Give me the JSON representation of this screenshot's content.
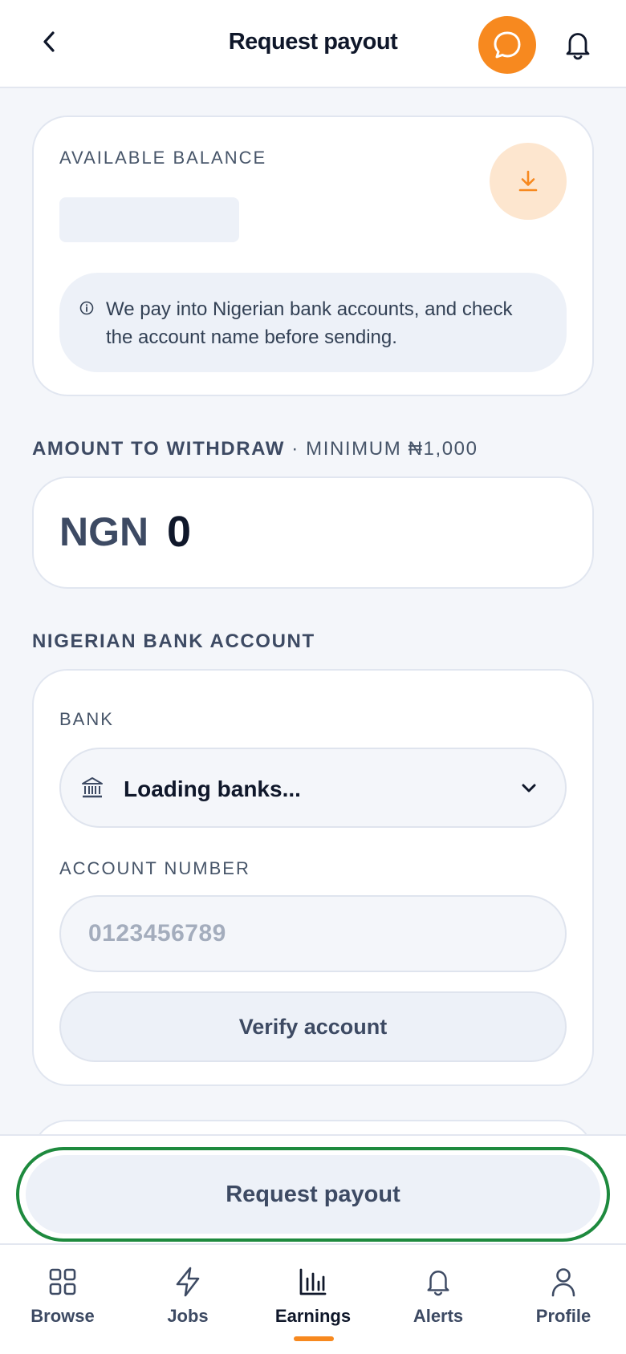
{
  "header": {
    "title": "Request payout",
    "back_icon": "chevron-left-icon",
    "chat_icon": "chat-bubble-icon",
    "notifications_icon": "bell-icon"
  },
  "balance": {
    "label": "AVAILABLE BALANCE",
    "download_icon": "download-icon",
    "info_icon": "info-icon",
    "info_text": "We pay into Nigerian bank accounts, and check the account name before sending."
  },
  "amount": {
    "section_title": "AMOUNT TO WITHDRAW",
    "section_separator": " · ",
    "section_minimum": "MINIMUM ₦1,000",
    "currency": "NGN",
    "value": "0"
  },
  "bank_account": {
    "section_title": "NIGERIAN BANK ACCOUNT",
    "bank_label": "BANK",
    "bank_icon": "bank-icon",
    "bank_select_value": "Loading banks...",
    "account_number_label": "ACCOUNT NUMBER",
    "account_number_placeholder": "0123456789",
    "account_number_value": "",
    "verify_label": "Verify account"
  },
  "footer": {
    "request_payout_label": "Request payout"
  },
  "nav": {
    "items": [
      {
        "label": "Browse",
        "icon": "grid-icon"
      },
      {
        "label": "Jobs",
        "icon": "lightning-icon"
      },
      {
        "label": "Earnings",
        "icon": "bar-chart-icon",
        "active": true
      },
      {
        "label": "Alerts",
        "icon": "bell-icon"
      },
      {
        "label": "Profile",
        "icon": "user-icon"
      }
    ]
  },
  "colors": {
    "accent": "#f7891f",
    "focus_ring": "#1e8a3e",
    "surface": "#ffffff",
    "background": "#f4f6fa",
    "muted_fill": "#edf1f8"
  }
}
